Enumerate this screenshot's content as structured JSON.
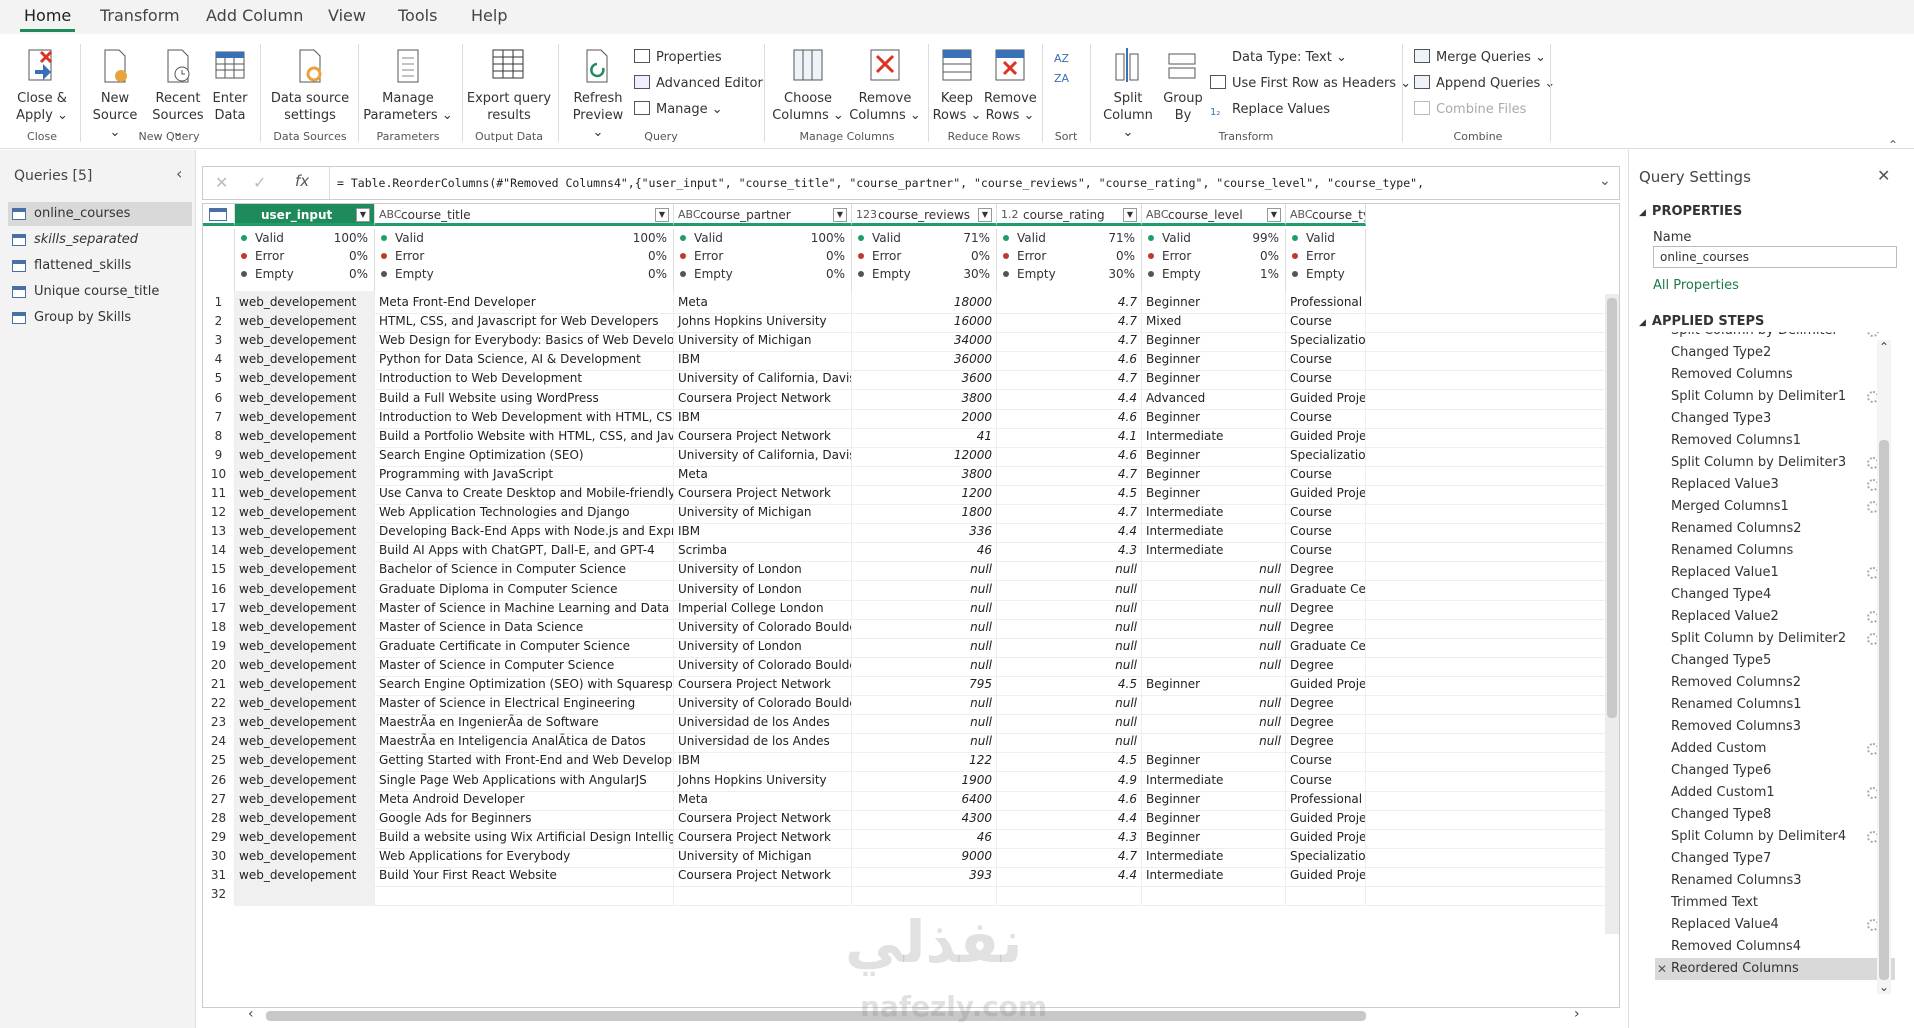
{
  "ribbon": {
    "tabs": [
      "Home",
      "Transform",
      "Add Column",
      "View",
      "Tools",
      "Help"
    ],
    "buttons": {
      "close_apply": "Close &",
      "close_apply2": "Apply ⌄",
      "new_source": "New",
      "new_source2": "Source ⌄",
      "recent_sources": "Recent",
      "recent_sources2": "Sources ⌄",
      "enter_data": "Enter",
      "enter_data2": "Data",
      "data_source_settings": "Data source",
      "data_source_settings2": "settings",
      "manage_parameters": "Manage",
      "manage_parameters2": "Parameters ⌄",
      "export_query": "Export query",
      "export_query2": "results",
      "refresh_preview": "Refresh",
      "refresh_preview2": "Preview ⌄",
      "properties": "Properties",
      "advanced_editor": "Advanced Editor",
      "manage": "Manage ⌄",
      "choose_columns": "Choose",
      "choose_columns2": "Columns ⌄",
      "remove_columns": "Remove",
      "remove_columns2": "Columns ⌄",
      "keep_rows": "Keep",
      "keep_rows2": "Rows ⌄",
      "remove_rows": "Remove",
      "remove_rows2": "Rows ⌄",
      "split_column": "Split",
      "split_column2": "Column ⌄",
      "group_by": "Group",
      "group_by2": "By",
      "data_type": "Data Type: Text ⌄",
      "first_row_headers": "Use First Row as Headers ⌄",
      "replace_values": "Replace Values",
      "merge_queries": "Merge Queries ⌄",
      "append_queries": "Append Queries ⌄",
      "combine_files": "Combine Files"
    },
    "groups": {
      "close": "Close",
      "new_query": "New Query",
      "data_sources": "Data Sources",
      "parameters": "Parameters",
      "query": "Query",
      "output_data": "Output Data",
      "manage_columns": "Manage Columns",
      "reduce_rows": "Reduce Rows",
      "sort": "Sort",
      "transform": "Transform",
      "combine": "Combine"
    }
  },
  "queries": {
    "title": "Queries [5]",
    "items": [
      "online_courses",
      "skills_separated",
      "flattened_skills",
      "Unique course_title",
      "Group by Skills"
    ]
  },
  "formula": "= Table.ReorderColumns(#\"Removed Columns4\",{\"user_input\", \"course_title\", \"course_partner\", \"course_reviews\", \"course_rating\", \"course_level\", \"course_type\",",
  "columns": [
    {
      "type": "",
      "name": "user_input",
      "q": [
        "100%",
        "0%",
        "0%"
      ]
    },
    {
      "type": "ABC",
      "name": "course_title",
      "q": [
        "100%",
        "0%",
        "0%"
      ]
    },
    {
      "type": "ABC",
      "name": "course_partner",
      "q": [
        "100%",
        "0%",
        "0%"
      ]
    },
    {
      "type": "123",
      "name": "course_reviews",
      "q": [
        "71%",
        "0%",
        "30%"
      ]
    },
    {
      "type": "1.2",
      "name": "course_rating",
      "q": [
        "71%",
        "0%",
        "30%"
      ]
    },
    {
      "type": "ABC",
      "name": "course_level",
      "q": [
        "99%",
        "0%",
        "1%"
      ]
    },
    {
      "type": "ABC",
      "name": "course_type",
      "q": [
        "",
        "",
        ""
      ]
    }
  ],
  "quality_labels": [
    "Valid",
    "Error",
    "Empty"
  ],
  "rows": [
    [
      "1",
      "web_developement",
      "Meta Front-End Developer",
      "Meta",
      "18000",
      "4.7",
      "Beginner",
      "Professional C"
    ],
    [
      "2",
      "web_developement",
      "HTML, CSS, and Javascript for Web Developers",
      "Johns Hopkins University",
      "16000",
      "4.7",
      "Mixed",
      "Course"
    ],
    [
      "3",
      "web_developement",
      "Web Design for Everybody: Basics of Web Development & Coding",
      "University of Michigan",
      "34000",
      "4.7",
      "Beginner",
      "Specialization"
    ],
    [
      "4",
      "web_developement",
      "Python for Data Science, AI & Development",
      "IBM",
      "36000",
      "4.6",
      "Beginner",
      "Course"
    ],
    [
      "5",
      "web_developement",
      "Introduction to Web Development",
      "University of California, Davis",
      "3600",
      "4.7",
      "Beginner",
      "Course"
    ],
    [
      "6",
      "web_developement",
      "Build a Full Website using WordPress",
      "Coursera Project Network",
      "3800",
      "4.4",
      "Advanced",
      "Guided Proje"
    ],
    [
      "7",
      "web_developement",
      "Introduction to Web Development with HTML, CSS, JavaScript",
      "IBM",
      "2000",
      "4.6",
      "Beginner",
      "Course"
    ],
    [
      "8",
      "web_developement",
      "Build a Portfolio Website with HTML, CSS, and JavaScript",
      "Coursera Project Network",
      "41",
      "4.1",
      "Intermediate",
      "Guided Proje"
    ],
    [
      "9",
      "web_developement",
      "Search Engine Optimization (SEO)",
      "University of California, Davis",
      "12000",
      "4.6",
      "Beginner",
      "Specialization"
    ],
    [
      "10",
      "web_developement",
      "Programming with JavaScript",
      "Meta",
      "3800",
      "4.7",
      "Beginner",
      "Course"
    ],
    [
      "11",
      "web_developement",
      "Use Canva to Create Desktop and Mobile-friendly Web Pages.",
      "Coursera Project Network",
      "1200",
      "4.5",
      "Beginner",
      "Guided Proje"
    ],
    [
      "12",
      "web_developement",
      "Web Application Technologies and Django",
      "University of Michigan",
      "1800",
      "4.7",
      "Intermediate",
      "Course"
    ],
    [
      "13",
      "web_developement",
      "Developing Back-End Apps with Node.js and Express",
      "IBM",
      "336",
      "4.4",
      "Intermediate",
      "Course"
    ],
    [
      "14",
      "web_developement",
      "Build AI Apps with ChatGPT, Dall-E, and GPT-4",
      "Scrimba",
      "46",
      "4.3",
      "Intermediate",
      "Course"
    ],
    [
      "15",
      "web_developement",
      "Bachelor of Science in Computer Science",
      "University of London",
      "null",
      "null",
      "null",
      "Degree"
    ],
    [
      "16",
      "web_developement",
      "Graduate Diploma in Computer Science",
      "University of London",
      "null",
      "null",
      "null",
      "Graduate Cer"
    ],
    [
      "17",
      "web_developement",
      "Master of Science in Machine Learning and Data Science",
      "Imperial College London",
      "null",
      "null",
      "null",
      "Degree"
    ],
    [
      "18",
      "web_developement",
      "Master of Science in Data Science",
      "University of Colorado Boulder",
      "null",
      "null",
      "null",
      "Degree"
    ],
    [
      "19",
      "web_developement",
      "Graduate Certificate in Computer Science",
      "University of London",
      "null",
      "null",
      "null",
      "Graduate Cer"
    ],
    [
      "20",
      "web_developement",
      "Master of Science in Computer Science",
      "University of Colorado Boulder",
      "null",
      "null",
      "null",
      "Degree"
    ],
    [
      "21",
      "web_developement",
      "Search Engine Optimization (SEO) with Squarespace",
      "Coursera Project Network",
      "795",
      "4.5",
      "Beginner",
      "Guided Proje"
    ],
    [
      "22",
      "web_developement",
      "Master of Science in Electrical Engineering",
      "University of Colorado Boulder",
      "null",
      "null",
      "null",
      "Degree"
    ],
    [
      "23",
      "web_developement",
      "MaestrÃa en IngenierÃa de Software",
      "Universidad de los Andes",
      "null",
      "null",
      "null",
      "Degree"
    ],
    [
      "24",
      "web_developement",
      "MaestrÃa en Inteligencia AnalÃtica de Datos",
      "Universidad de los Andes",
      "null",
      "null",
      "null",
      "Degree"
    ],
    [
      "25",
      "web_developement",
      "Getting Started with Front-End and Web Development",
      "IBM",
      "122",
      "4.5",
      "Beginner",
      "Course"
    ],
    [
      "26",
      "web_developement",
      "Single Page Web Applications with AngularJS",
      "Johns Hopkins University",
      "1900",
      "4.9",
      "Intermediate",
      "Course"
    ],
    [
      "27",
      "web_developement",
      "Meta Android Developer",
      "Meta",
      "6400",
      "4.6",
      "Beginner",
      "Professional C"
    ],
    [
      "28",
      "web_developement",
      "Google Ads for Beginners",
      "Coursera Project Network",
      "4300",
      "4.4",
      "Beginner",
      "Guided Proje"
    ],
    [
      "29",
      "web_developement",
      "Build a website using Wix Artificial Design Intelligence",
      "Coursera Project Network",
      "46",
      "4.3",
      "Beginner",
      "Guided Proje"
    ],
    [
      "30",
      "web_developement",
      "Web Applications for Everybody",
      "University of Michigan",
      "9000",
      "4.7",
      "Intermediate",
      "Specialization"
    ],
    [
      "31",
      "web_developement",
      "Build Your First React Website",
      "Coursera Project Network",
      "393",
      "4.4",
      "Intermediate",
      "Guided Proje"
    ],
    [
      "32",
      "",
      "",
      "",
      "",
      "",
      "",
      ""
    ]
  ],
  "settings": {
    "title": "Query Settings",
    "properties_label": "PROPERTIES",
    "name_label": "Name",
    "name_value": "online_courses",
    "all_properties": "All Properties",
    "applied_steps_label": "APPLIED STEPS",
    "steps": [
      "Split Column by Delimiter",
      "Changed Type2",
      "Removed Columns",
      "Split Column by Delimiter1",
      "Changed Type3",
      "Removed Columns1",
      "Split Column by Delimiter3",
      "Replaced Value3",
      "Merged Columns1",
      "Renamed Columns2",
      "Renamed Columns",
      "Replaced Value1",
      "Changed Type4",
      "Replaced Value2",
      "Split Column by Delimiter2",
      "Changed Type5",
      "Removed Columns2",
      "Renamed Columns1",
      "Removed Columns3",
      "Added Custom",
      "Changed Type6",
      "Added Custom1",
      "Changed Type8",
      "Split Column by Delimiter4",
      "Changed Type7",
      "Renamed Columns3",
      "Trimmed Text",
      "Replaced Value4",
      "Removed Columns4",
      "Reordered Columns"
    ],
    "gear_steps": [
      0,
      3,
      6,
      7,
      8,
      11,
      13,
      14,
      19,
      21,
      23,
      27
    ]
  },
  "watermark": {
    "ar": "نفذلي",
    "en": "nafezly.com"
  },
  "colors": {
    "accent": "#1f8a5a",
    "quality_bar": "#1f9e6a",
    "valid_dot": "#1f9e6a",
    "error_dot": "#c0392b",
    "empty_dot": "#555555"
  }
}
